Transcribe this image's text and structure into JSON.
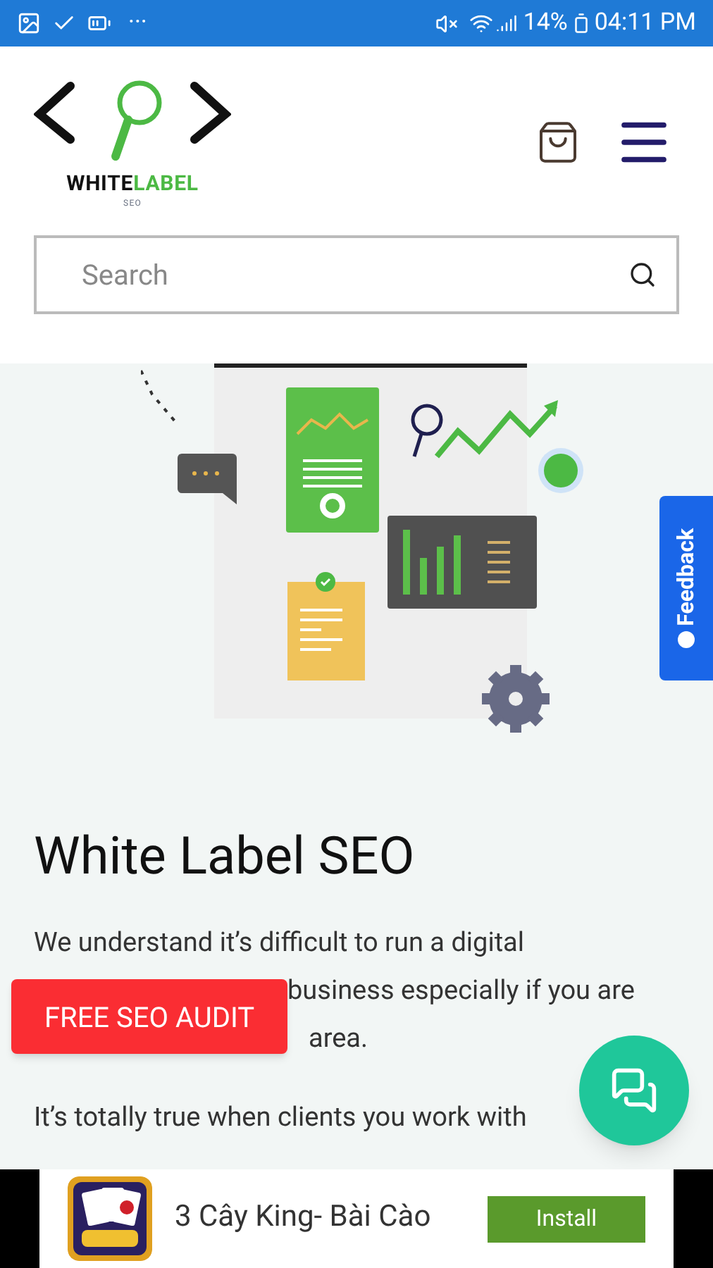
{
  "status_bar": {
    "icons_left_more": "···",
    "battery_percent": "14%",
    "time": "04:11 PM"
  },
  "header": {
    "logo": {
      "word_dark": "WHITE",
      "word_green": "LABEL",
      "tagline": "SEO"
    }
  },
  "search": {
    "placeholder": "Search"
  },
  "feedback_tab": {
    "label": "Feedback"
  },
  "article": {
    "title": "White Label SEO",
    "paragraphs": [
      {
        "lines": [
          "We understand it’s difficult to run a digital",
          "business especially if you are",
          "area."
        ]
      },
      {
        "lines": [
          "It’s totally true when clients you work with"
        ]
      }
    ]
  },
  "audit_button": {
    "label": "FREE SEO AUDIT"
  },
  "ad": {
    "app_name": "3 Cây King- Bài Cào",
    "install_label": "Install"
  }
}
